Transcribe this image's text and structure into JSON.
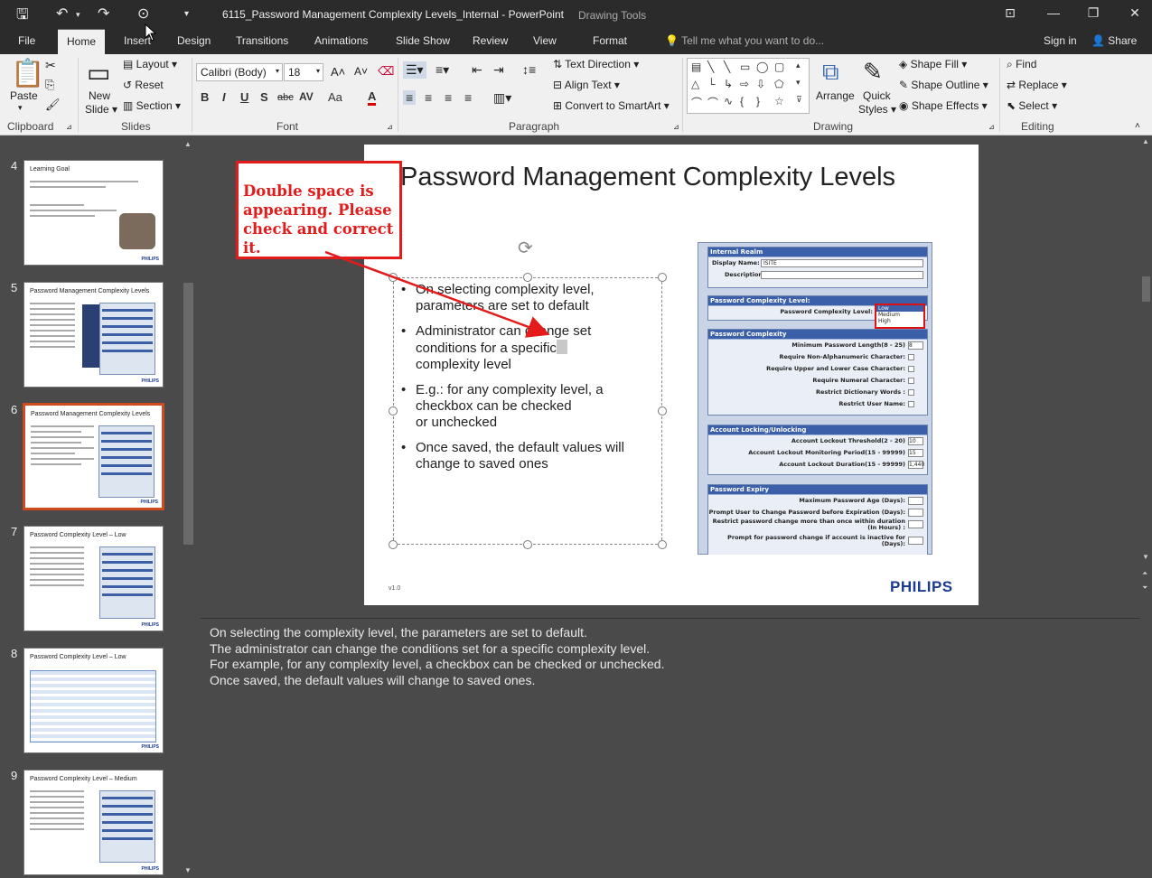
{
  "window": {
    "title": "6115_Password Management Complexity Levels_Internal - PowerPoint",
    "context_tab_group": "Drawing Tools"
  },
  "tabs": [
    "File",
    "Home",
    "Insert",
    "Design",
    "Transitions",
    "Animations",
    "Slide Show",
    "Review",
    "View",
    "Format"
  ],
  "active_tab": "Home",
  "tell_me": "Tell me what you want to do...",
  "sign_in": "Sign in",
  "share": "Share",
  "ribbon": {
    "clipboard": {
      "paste": "Paste",
      "label": "Clipboard"
    },
    "slides": {
      "new_slide": "New",
      "new_slide2": "Slide ▾",
      "layout": "Layout ▾",
      "reset": "Reset",
      "section": "Section ▾",
      "label": "Slides"
    },
    "font": {
      "name": "Calibri (Body)",
      "size": "18",
      "bold": "B",
      "italic": "I",
      "underline": "U",
      "shadow": "S",
      "strike": "abc",
      "spacing": "AV",
      "case": "Aa",
      "color": "A",
      "label": "Font"
    },
    "paragraph": {
      "text_direction": "Text Direction ▾",
      "align_text": "Align Text ▾",
      "convert_smartart": "Convert to SmartArt ▾",
      "label": "Paragraph"
    },
    "drawing": {
      "arrange": "Arrange",
      "quick_styles": "Quick",
      "quick_styles2": "Styles ▾",
      "shape_fill": "Shape Fill ▾",
      "shape_outline": "Shape Outline ▾",
      "shape_effects": "Shape Effects ▾",
      "label": "Drawing"
    },
    "editing": {
      "find": "Find",
      "replace": "Replace ▾",
      "select": "Select ▾",
      "label": "Editing"
    }
  },
  "thumbnails": [
    {
      "num": "4",
      "title": "Learning Goal"
    },
    {
      "num": "5",
      "title": "Password Management Complexity Levels"
    },
    {
      "num": "6",
      "title": "Password Management Complexity Levels"
    },
    {
      "num": "7",
      "title": "Password Complexity Level – Low"
    },
    {
      "num": "8",
      "title": "Password Complexity Level – Low"
    },
    {
      "num": "9",
      "title": "Password Complexity Level – Medium"
    }
  ],
  "thumb_brand": "PHILIPS",
  "slide": {
    "title": "Password Management Complexity Levels",
    "bullets": {
      "b1_l1": "On selecting complexity level,",
      "b1_l2": "parameters are set to default",
      "b2_l1": "Administrator can change set",
      "b2_l2": "conditions for a specific",
      "b2_l3": "complexity level",
      "b3_l1": "E.g.: for any complexity level, a",
      "b3_l2": "checkbox can be checked",
      "b3_l3": "or unchecked",
      "b4_l1": "Once saved, the default values will",
      "b4_l2": "change to saved ones"
    },
    "version": "v1.0",
    "brand": "PHILIPS",
    "screenshot": {
      "realm_head": "Internal Realm",
      "display_name_label": "Display Name:",
      "display_name_value": "ISITE",
      "description_label": "Description:",
      "complexity_head": "Password Complexity Level:",
      "complexity_label": "Password Complexity Level:",
      "options": [
        "Low",
        "Medium",
        "High"
      ],
      "pc_head": "Password Complexity",
      "min_len_label": "Minimum Password Length(8 - 25)",
      "min_len_value": "8",
      "non_alpha": "Require Non-Alphanumeric Character:",
      "upper_lower": "Require Upper and Lower Case Character:",
      "numeral": "Require Numeral Character:",
      "dictionary": "Restrict Dictionary Words :",
      "username": "Restrict User Name:",
      "lock_head": "Account Locking/Unlocking",
      "lock_threshold": "Account Lockout Threshold(2 - 20)",
      "lock_threshold_value": "10",
      "lock_period": "Account Lockout Monitoring Period(15 - 99999)",
      "lock_period_value": "15",
      "lock_duration": "Account Lockout Duration(15 - 99999)",
      "lock_duration_value": "1,440",
      "expiry_head": "Password Expiry",
      "max_age": "Maximum Password Age (Days):",
      "prompt_change": "Prompt User to Change Password before Expiration (Days):",
      "restrict_change": "Restrict password change more than once within duration",
      "restrict_change2": "(In Hours) :",
      "prompt_inactive": "Prompt for password change if account is inactive for",
      "prompt_inactive2": "(Days):"
    }
  },
  "callout": {
    "text": "Double space is appearing. Please check and correct it.",
    "color": "#e31b1b"
  },
  "notes": {
    "l1": "On selecting the complexity level, the parameters are set to default.",
    "l2": "The administrator can change the conditions set for a specific complexity level.",
    "l3": "For example, for any complexity level, a checkbox can be checked or unchecked.",
    "l4": "Once saved, the default values will change to saved ones."
  },
  "colors": {
    "selection_border": "#d04a20",
    "brand_blue": "#1a3b8f"
  }
}
